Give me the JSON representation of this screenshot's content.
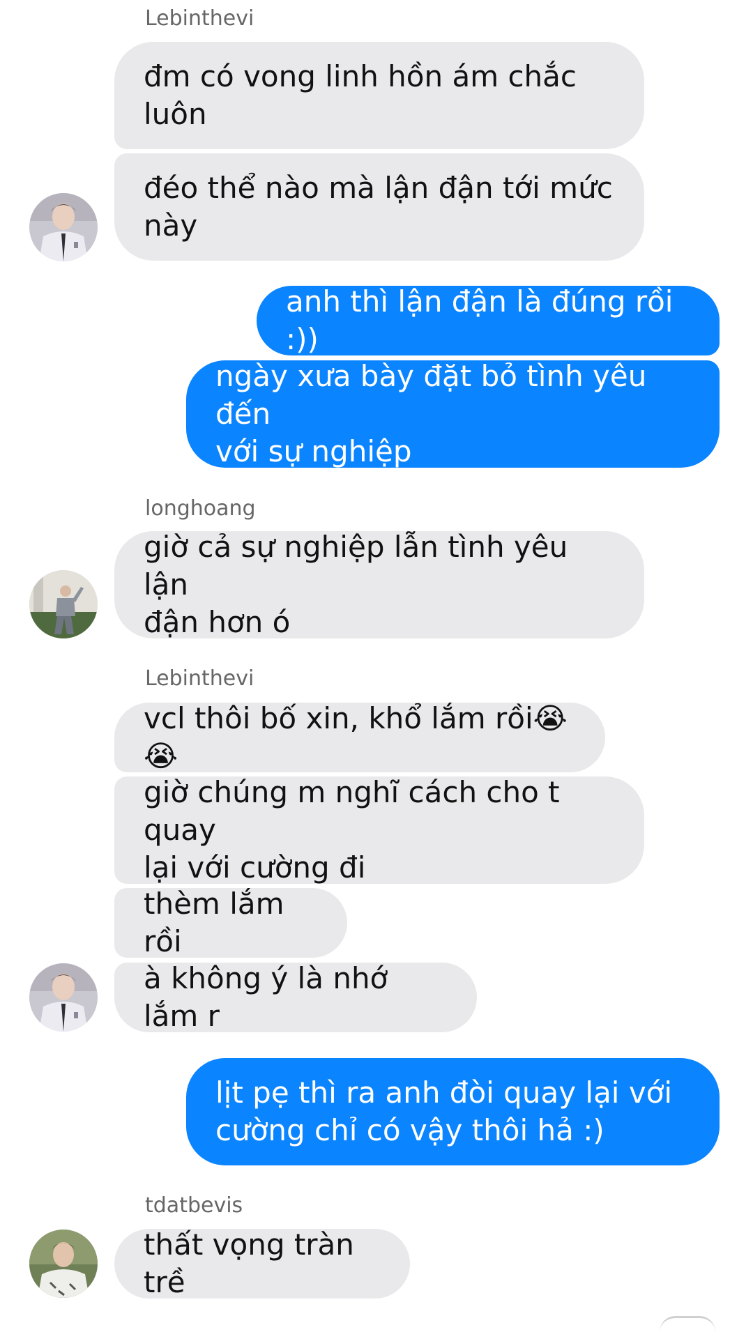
{
  "conversation": {
    "groups": [
      {
        "sender": "Lebinthevi",
        "messages": [
          "đm có vong linh hồn ám chắc\nluôn",
          "đéo thể nào mà lận đận tới mức\nnày"
        ],
        "avatar": "avatar-lebinthevi"
      },
      {
        "sender": "me",
        "messages": [
          "anh thì lận đận là đúng rồi :))",
          "ngày xưa bày đặt bỏ tình yêu đến\nvới sự nghiệp"
        ]
      },
      {
        "sender": "longhoang",
        "messages": [
          "giờ cả sự nghiệp lẫn tình yêu lận\nđận hơn ó"
        ],
        "avatar": "avatar-longhoang"
      },
      {
        "sender": "Lebinthevi",
        "messages": [
          "vcl thôi bố xin, khổ lắm rồi😭😭",
          "giờ chúng m nghĩ cách cho t quay\nlại với cường đi",
          "thèm lắm rồi",
          "à không ý là nhớ lắm r"
        ],
        "avatar": "avatar-lebinthevi"
      },
      {
        "sender": "me",
        "messages": [
          "lịt pẹ thì ra anh đòi quay lại với\ncường chỉ có vậy thôi hả :)"
        ]
      },
      {
        "sender": "tdatbevis",
        "messages": [
          "thất vọng tràn trề"
        ],
        "avatar": "avatar-tdatbevis"
      }
    ]
  },
  "colors": {
    "incoming_bubble": "#e9e9eb",
    "outgoing_bubble": "#0a84ff",
    "sender_label": "#666666"
  }
}
